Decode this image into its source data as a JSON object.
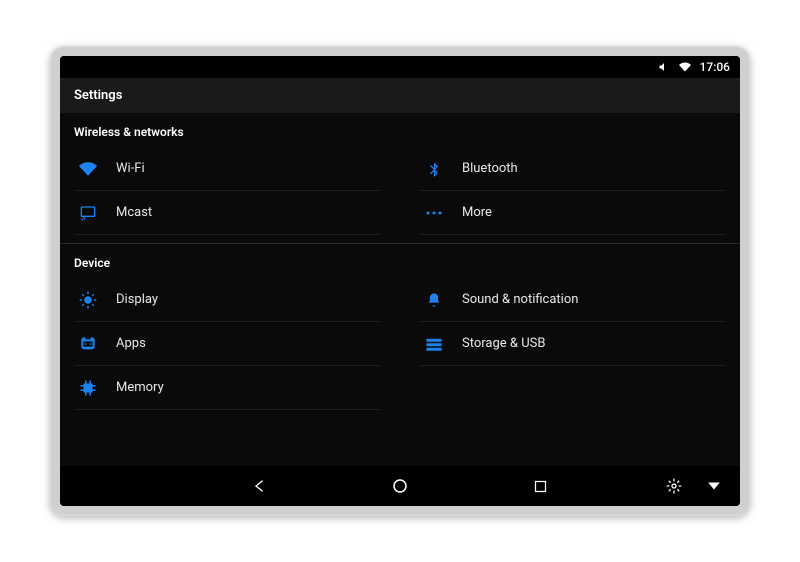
{
  "status": {
    "time": "17:06"
  },
  "header": {
    "title": "Settings"
  },
  "sections": {
    "wireless": {
      "title": "Wireless & networks",
      "items": {
        "wifi": "Wi-Fi",
        "bluetooth": "Bluetooth",
        "mcast": "Mcast",
        "more": "More"
      }
    },
    "device": {
      "title": "Device",
      "items": {
        "display": "Display",
        "sound": "Sound & notification",
        "apps": "Apps",
        "storage": "Storage & USB",
        "memory": "Memory"
      }
    }
  }
}
